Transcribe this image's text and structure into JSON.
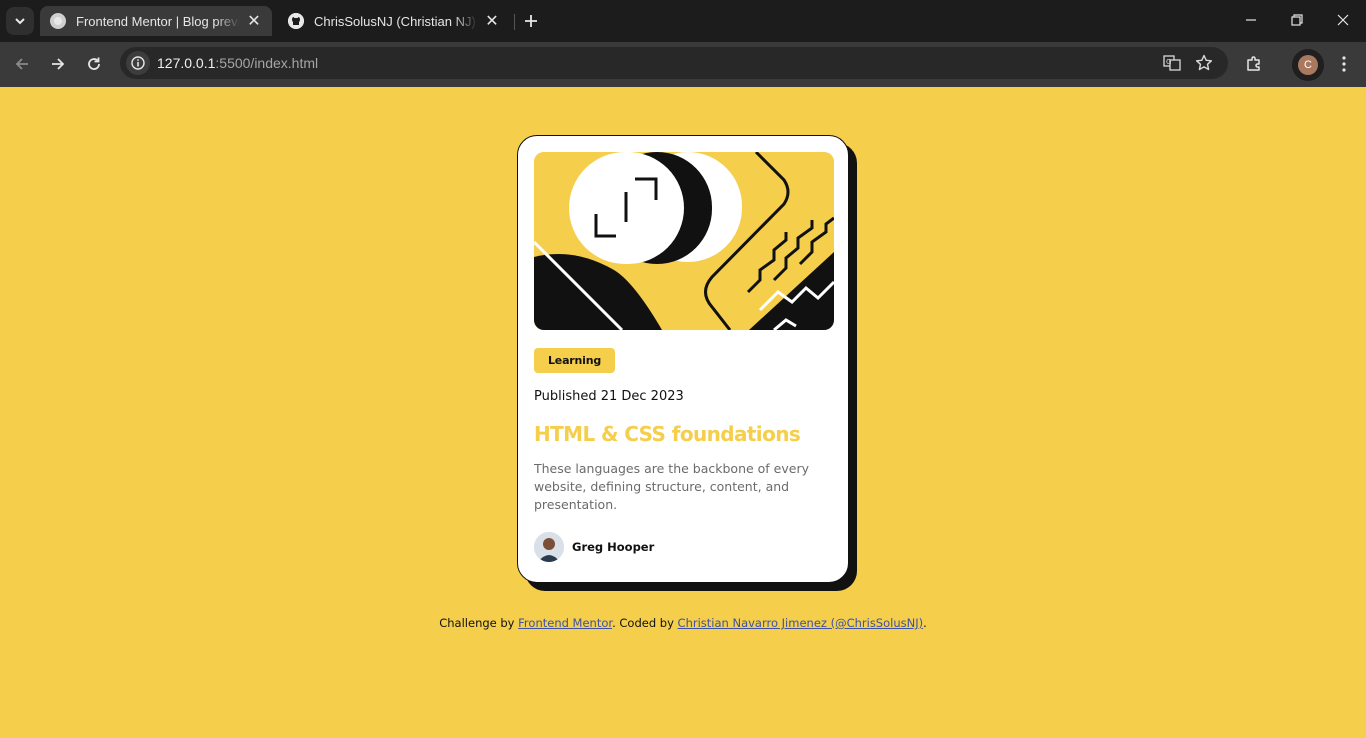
{
  "browser": {
    "tabs": [
      {
        "title": "Frontend Mentor | Blog preview card",
        "active": true
      },
      {
        "title": "ChrisSolusNJ (Christian NJ) · GitHub",
        "active": false
      }
    ],
    "address": {
      "host": "127.0.0.1",
      "path": ":5500/index.html"
    },
    "profile_initial": "C",
    "icons": {
      "tab_search": "chevron-down-icon",
      "new_tab": "plus-icon",
      "back": "arrow-left-icon",
      "forward": "arrow-right-icon",
      "reload": "reload-icon",
      "site_info": "info-icon",
      "translate": "translate-icon",
      "bookmark": "star-icon",
      "extensions": "puzzle-icon",
      "menu": "kebab-menu-icon",
      "minimize": "minimize-icon",
      "restore": "restore-icon",
      "close": "close-icon"
    },
    "colors": {
      "frame": "#1c1c1c",
      "toolbar": "#3a3a3a"
    }
  },
  "card": {
    "tag": "Learning",
    "published": "Published 21 Dec 2023",
    "title": "HTML & CSS foundations",
    "description": "These languages are the backbone of every website, defining structure, content, and presentation.",
    "author": "Greg Hooper"
  },
  "attribution": {
    "prefix": "Challenge by ",
    "link1": "Frontend Mentor",
    "middle": ". Coded by ",
    "link2": "Christian Navarro Jimenez (@ChrisSolusNJ)",
    "suffix": "."
  },
  "colors": {
    "page_bg": "#f5ce4b",
    "accent": "#f5ce4b",
    "ink": "#111111",
    "link": "#3e52a3"
  }
}
